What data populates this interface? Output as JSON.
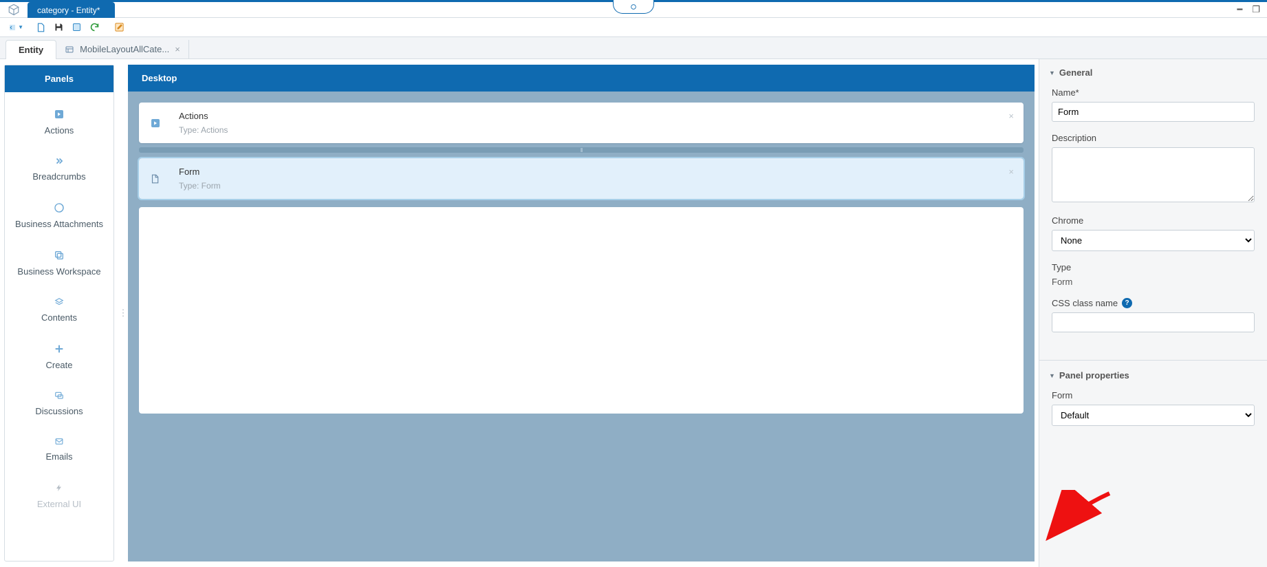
{
  "window": {
    "title": "category - Entity*"
  },
  "subtabs": {
    "entity_label": "Entity",
    "doc_label": "MobileLayoutAllCate..."
  },
  "palette": {
    "header": "Panels",
    "items": [
      {
        "label": "Actions",
        "icon": "arrow-right-box"
      },
      {
        "label": "Breadcrumbs",
        "icon": "chevrons-right"
      },
      {
        "label": "Business Attachments",
        "icon": "swirl"
      },
      {
        "label": "Business Workspace",
        "icon": "copy"
      },
      {
        "label": "Contents",
        "icon": "layers"
      },
      {
        "label": "Create",
        "icon": "plus"
      },
      {
        "label": "Discussions",
        "icon": "chat"
      },
      {
        "label": "Emails",
        "icon": "envelope"
      },
      {
        "label": "External UI",
        "icon": "bolt",
        "faded": true
      }
    ]
  },
  "canvas": {
    "header": "Desktop",
    "cards": [
      {
        "title": "Actions",
        "subtitle": "Type: Actions",
        "icon": "arrow-right-box",
        "selected": false
      },
      {
        "title": "Form",
        "subtitle": "Type: Form",
        "icon": "file",
        "selected": true
      }
    ]
  },
  "props": {
    "section_general": "General",
    "name_label": "Name*",
    "name_value": "Form",
    "description_label": "Description",
    "description_value": "",
    "chrome_label": "Chrome",
    "chrome_value": "None",
    "type_label": "Type",
    "type_value": "Form",
    "css_label": "CSS class name",
    "css_value": "",
    "section_panel": "Panel properties",
    "form_label": "Form",
    "form_value": "Default"
  }
}
